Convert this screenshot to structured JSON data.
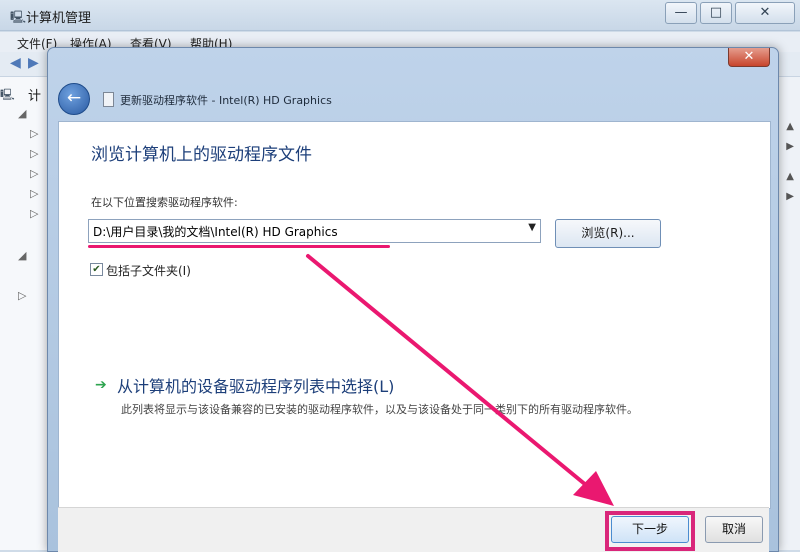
{
  "background_window": {
    "title": "计算机管理",
    "menu": [
      "文件(F)",
      "操作(A)",
      "查看(V)",
      "帮助(H)"
    ],
    "tree_root_label": "计",
    "controls": {
      "minimize": "—",
      "maximize": "□",
      "close": "✕"
    }
  },
  "dialog": {
    "title": "更新驱动程序软件 - Intel(R) HD Graphics",
    "close_label": "✕",
    "heading": "浏览计算机上的驱动程序文件",
    "search_label": "在以下位置搜索驱动程序软件:",
    "path_value": "D:\\用户目录\\我的文档\\Intel(R) HD Graphics",
    "browse_label": "浏览(R)...",
    "include_subfolders_label": "包括子文件夹(I)",
    "include_subfolders_checked": true,
    "option_title": "从计算机的设备驱动程序列表中选择(L)",
    "option_desc": "此列表将显示与该设备兼容的已安装的驱动程序软件，以及与该设备处于同一类别下的所有驱动程序软件。",
    "next_label": "下一步",
    "cancel_label": "取消"
  },
  "icons": {
    "back": "back-arrow-icon",
    "green_arrow": "green-arrow-icon",
    "check": "✔"
  },
  "colors": {
    "annotation": "#ea1870",
    "heading": "#1d3f7a",
    "option_arrow": "#2ea44f"
  }
}
